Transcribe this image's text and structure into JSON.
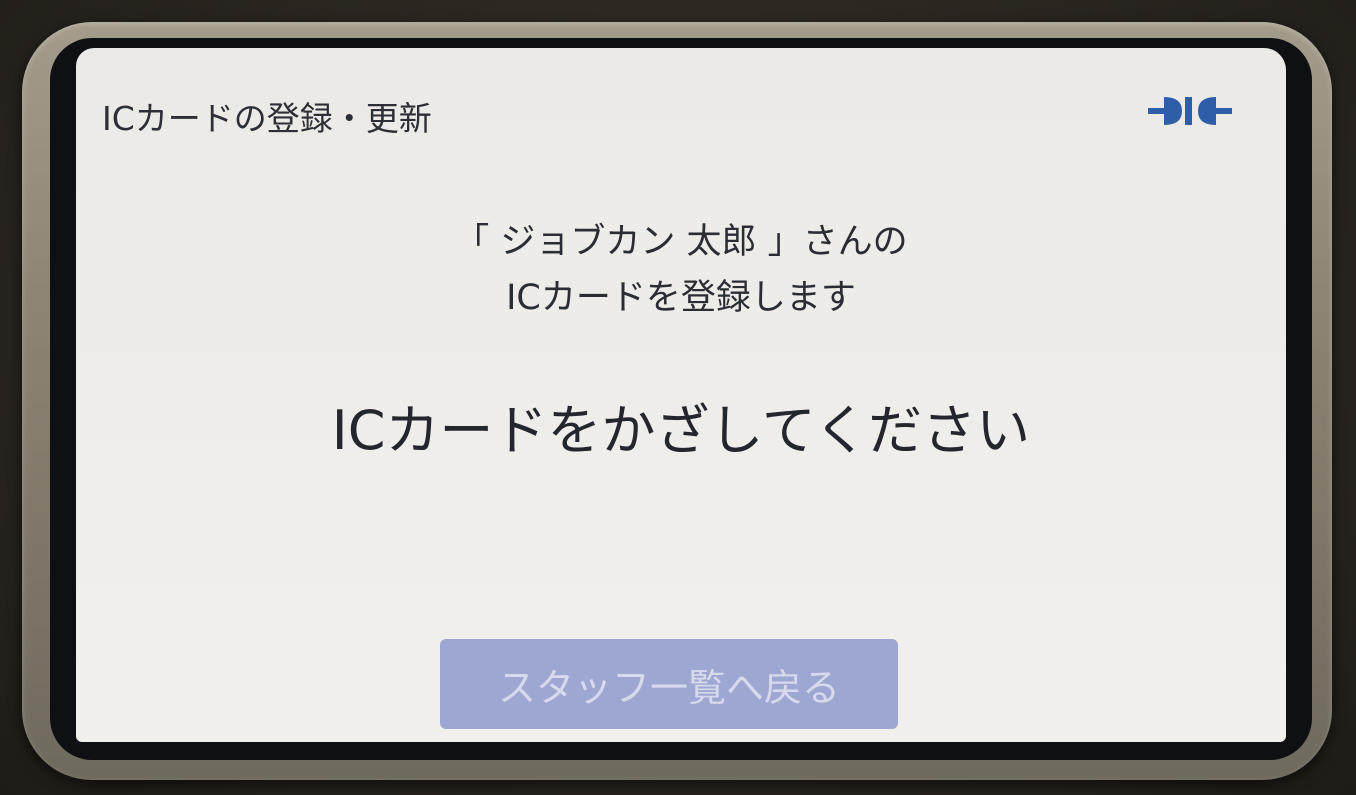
{
  "header": {
    "title": "ICカードの登録・更新",
    "status_icon": "connection-plug-icon",
    "status_icon_color": "#2f5ea8"
  },
  "message": {
    "line1": "「 ジョブカン 太郎 」さんの",
    "line2": "ICカードを登録します"
  },
  "instruction": "ICカードをかざしてください",
  "back_button": {
    "label": "スタッフ一覧へ戻る",
    "color": "#9ea6d2"
  }
}
